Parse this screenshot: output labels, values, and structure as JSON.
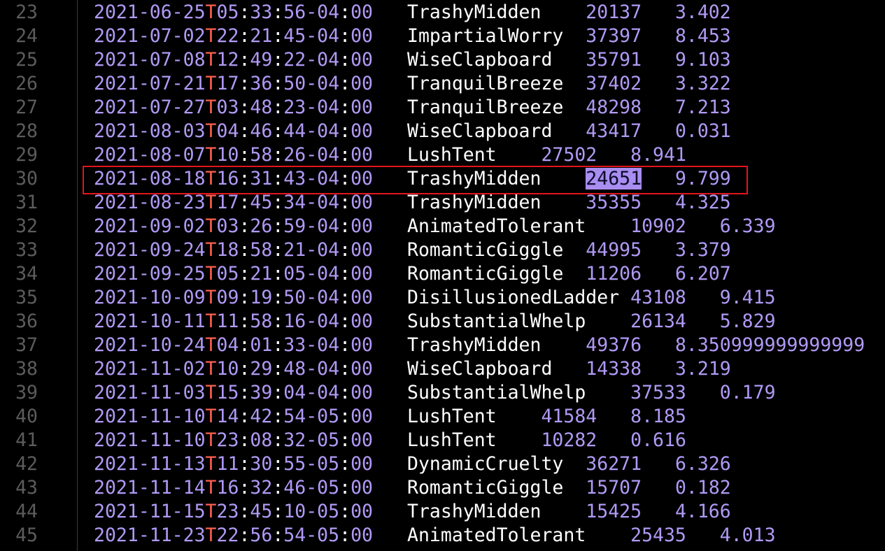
{
  "editor": {
    "lines": [
      {
        "n": "23",
        "date": "2021-06-25",
        "time": "05:33:56",
        "tz": "-04",
        "name": "TrashyMidden",
        "gap1": "    ",
        "value": "20137",
        "gap2": "   ",
        "score": "3.402"
      },
      {
        "n": "24",
        "date": "2021-07-02",
        "time": "22:21:45",
        "tz": "-04",
        "name": "ImpartialWorry",
        "gap1": "  ",
        "value": "37397",
        "gap2": "   ",
        "score": "8.453"
      },
      {
        "n": "25",
        "date": "2021-07-08",
        "time": "12:49:22",
        "tz": "-04",
        "name": "WiseClapboard",
        "gap1": "   ",
        "value": "35791",
        "gap2": "   ",
        "score": "9.103"
      },
      {
        "n": "26",
        "date": "2021-07-21",
        "time": "17:36:50",
        "tz": "-04",
        "name": "TranquilBreeze",
        "gap1": "  ",
        "value": "37402",
        "gap2": "   ",
        "score": "3.322"
      },
      {
        "n": "27",
        "date": "2021-07-27",
        "time": "03:48:23",
        "tz": "-04",
        "name": "TranquilBreeze",
        "gap1": "  ",
        "value": "48298",
        "gap2": "   ",
        "score": "7.213"
      },
      {
        "n": "28",
        "date": "2021-08-03",
        "time": "04:46:44",
        "tz": "-04",
        "name": "WiseClapboard",
        "gap1": "   ",
        "value": "43417",
        "gap2": "   ",
        "score": "0.031"
      },
      {
        "n": "29",
        "date": "2021-08-07",
        "time": "10:58:26",
        "tz": "-04",
        "name": "LushTent",
        "gap1": "    ",
        "value": "27502",
        "gap2": "   ",
        "score": "8.941"
      },
      {
        "n": "30",
        "date": "2021-08-18",
        "time": "16:31:43",
        "tz": "-04",
        "name": "TrashyMidden",
        "gap1": "    ",
        "value": "24651",
        "gap2": "   ",
        "score": "9.799"
      },
      {
        "n": "31",
        "date": "2021-08-23",
        "time": "17:45:34",
        "tz": "-04",
        "name": "TrashyMidden",
        "gap1": "    ",
        "value": "35355",
        "gap2": "   ",
        "score": "4.325"
      },
      {
        "n": "32",
        "date": "2021-09-02",
        "time": "03:26:59",
        "tz": "-04",
        "name": "AnimatedTolerant",
        "gap1": "    ",
        "value": "10902",
        "gap2": "   ",
        "score": "6.339"
      },
      {
        "n": "33",
        "date": "2021-09-24",
        "time": "18:58:21",
        "tz": "-04",
        "name": "RomanticGiggle",
        "gap1": "  ",
        "value": "44995",
        "gap2": "   ",
        "score": "3.379"
      },
      {
        "n": "34",
        "date": "2021-09-25",
        "time": "05:21:05",
        "tz": "-04",
        "name": "RomanticGiggle",
        "gap1": "  ",
        "value": "11206",
        "gap2": "   ",
        "score": "6.207"
      },
      {
        "n": "35",
        "date": "2021-10-09",
        "time": "09:19:50",
        "tz": "-04",
        "name": "DisillusionedLadder",
        "gap1": " ",
        "value": "43108",
        "gap2": "   ",
        "score": "9.415"
      },
      {
        "n": "36",
        "date": "2021-10-11",
        "time": "11:58:16",
        "tz": "-04",
        "name": "SubstantialWhelp",
        "gap1": "    ",
        "value": "26134",
        "gap2": "   ",
        "score": "5.829"
      },
      {
        "n": "37",
        "date": "2021-10-24",
        "time": "04:01:33",
        "tz": "-04",
        "name": "TrashyMidden",
        "gap1": "    ",
        "value": "49376",
        "gap2": "   ",
        "score": "8.350999999999999"
      },
      {
        "n": "38",
        "date": "2021-11-02",
        "time": "10:29:48",
        "tz": "-04",
        "name": "WiseClapboard",
        "gap1": "   ",
        "value": "14338",
        "gap2": "   ",
        "score": "3.219"
      },
      {
        "n": "39",
        "date": "2021-11-03",
        "time": "15:39:04",
        "tz": "-04",
        "name": "SubstantialWhelp",
        "gap1": "    ",
        "value": "37533",
        "gap2": "   ",
        "score": "0.179"
      },
      {
        "n": "40",
        "date": "2021-11-10",
        "time": "14:42:54",
        "tz": "-05",
        "name": "LushTent",
        "gap1": "    ",
        "value": "41584",
        "gap2": "   ",
        "score": "8.185"
      },
      {
        "n": "41",
        "date": "2021-11-10",
        "time": "23:08:32",
        "tz": "-05",
        "name": "LushTent",
        "gap1": "    ",
        "value": "10282",
        "gap2": "   ",
        "score": "0.616"
      },
      {
        "n": "42",
        "date": "2021-11-13",
        "time": "11:30:55",
        "tz": "-05",
        "name": "DynamicCruelty",
        "gap1": "  ",
        "value": "36271",
        "gap2": "   ",
        "score": "6.326"
      },
      {
        "n": "43",
        "date": "2021-11-14",
        "time": "16:32:46",
        "tz": "-05",
        "name": "RomanticGiggle",
        "gap1": "  ",
        "value": "15707",
        "gap2": "   ",
        "score": "0.182"
      },
      {
        "n": "44",
        "date": "2021-11-15",
        "time": "23:45:10",
        "tz": "-05",
        "name": "TrashyMidden",
        "gap1": "    ",
        "value": "15425",
        "gap2": "   ",
        "score": "4.166"
      },
      {
        "n": "45",
        "date": "2021-11-23",
        "time": "22:56:54",
        "tz": "-05",
        "name": "AnimatedTolerant",
        "gap1": "    ",
        "value": "25435",
        "gap2": "   ",
        "score": "4.013"
      }
    ],
    "tz_minutes": "00",
    "selected_match": "24651",
    "colors": {
      "background": "#000000",
      "line_number": "#5c5c5c",
      "timestamp": "#b09af5",
      "t_separator": "#ff5f4f",
      "name": "#ffffff",
      "match_highlight": "#a98df0",
      "annotation_box": "#e2161b"
    }
  }
}
